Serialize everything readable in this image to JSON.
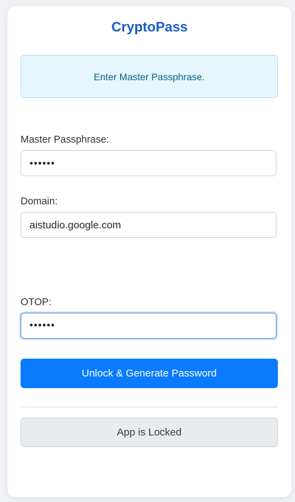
{
  "app": {
    "title": "CryptoPass"
  },
  "status": {
    "message": "Enter Master Passphrase."
  },
  "form": {
    "master_passphrase": {
      "label": "Master Passphrase:",
      "value": "••••••"
    },
    "domain": {
      "label": "Domain:",
      "value": "aistudio.google.com"
    },
    "otop": {
      "label": "OTOP:",
      "value": "••••••"
    }
  },
  "actions": {
    "unlock_label": "Unlock & Generate Password",
    "locked_label": "App is Locked"
  },
  "colors": {
    "accent": "#0a7bff",
    "title": "#1a5cc8",
    "status_bg": "#e6f6fd"
  }
}
